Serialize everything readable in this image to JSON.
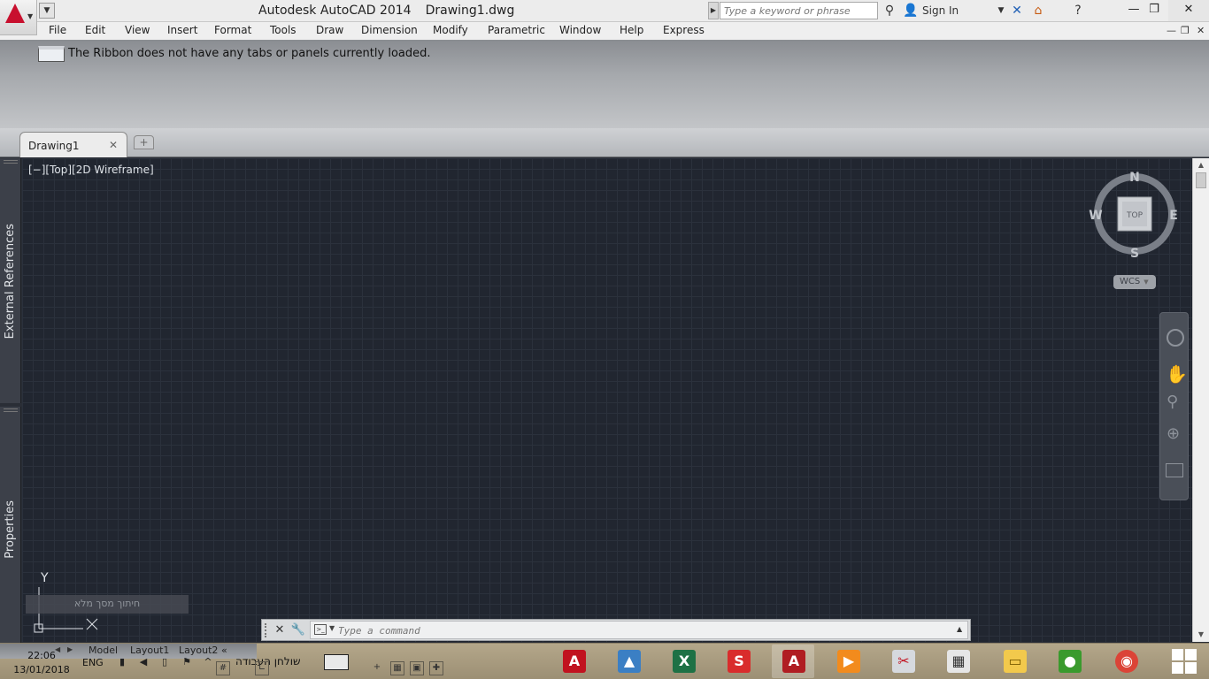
{
  "window": {
    "app_title": "Autodesk AutoCAD 2014",
    "document_title": "Drawing1.dwg",
    "search_placeholder": "Type a keyword or phrase",
    "sign_in": "Sign In",
    "minimize": "—",
    "maximize": "❐",
    "close": "✕"
  },
  "menu": {
    "items": [
      "File",
      "Edit",
      "View",
      "Insert",
      "Format",
      "Tools",
      "Draw",
      "Dimension",
      "Modify",
      "Parametric",
      "Window",
      "Help",
      "Express"
    ]
  },
  "ribbon": {
    "message": "The Ribbon does not have any tabs or panels currently loaded."
  },
  "file_tabs": {
    "active": "Drawing1",
    "close": "✕",
    "new_tab": "+"
  },
  "palettes": {
    "external_references": "External References",
    "properties": "Properties"
  },
  "viewport": {
    "label": "[−][Top][2D Wireframe]",
    "hint": "חיתוך מסך מלא",
    "viewcube": {
      "north": "N",
      "south": "S",
      "east": "E",
      "west": "W",
      "face": "TOP",
      "ucs": "WCS"
    },
    "ucs_icon": {
      "y_axis": "Y"
    }
  },
  "command_line": {
    "placeholder": "Type a command",
    "close": "✕",
    "customize": "🔧"
  },
  "layout_tabs": {
    "items": [
      "Model",
      "Layout1",
      "Layout2"
    ],
    "more": "«"
  },
  "taskbar": {
    "time": "22:06",
    "date": "13/01/2018",
    "language": "ENG",
    "workspace": "שולחן העבודה",
    "apps": [
      {
        "name": "Adobe Acrobat",
        "icon": "acrobat-icon",
        "color": "#c1121f"
      },
      {
        "name": "Photos",
        "icon": "photos-icon",
        "color": "#3b7fc4"
      },
      {
        "name": "Excel",
        "icon": "excel-icon",
        "color": "#1e7145"
      },
      {
        "name": "SketchUp",
        "icon": "sketchup-icon",
        "color": "#d92c2c"
      },
      {
        "name": "AutoCAD",
        "icon": "autocad-icon",
        "color": "#b01d22"
      },
      {
        "name": "Media Player",
        "icon": "media-player-icon",
        "color": "#f28b1d"
      },
      {
        "name": "Snipping Tool",
        "icon": "snipping-tool-icon",
        "color": "#d6d9de"
      },
      {
        "name": "Calculator",
        "icon": "calculator-icon",
        "color": "#e6e6e6"
      },
      {
        "name": "File Explorer",
        "icon": "file-explorer-icon",
        "color": "#f2c94c"
      },
      {
        "name": "Internet Download Manager",
        "icon": "idm-icon",
        "color": "#3a9a2d"
      },
      {
        "name": "Chrome",
        "icon": "chrome-icon",
        "color": "#db4437"
      }
    ]
  },
  "colors": {
    "canvas": "#212630",
    "accent": "#c8102e"
  }
}
